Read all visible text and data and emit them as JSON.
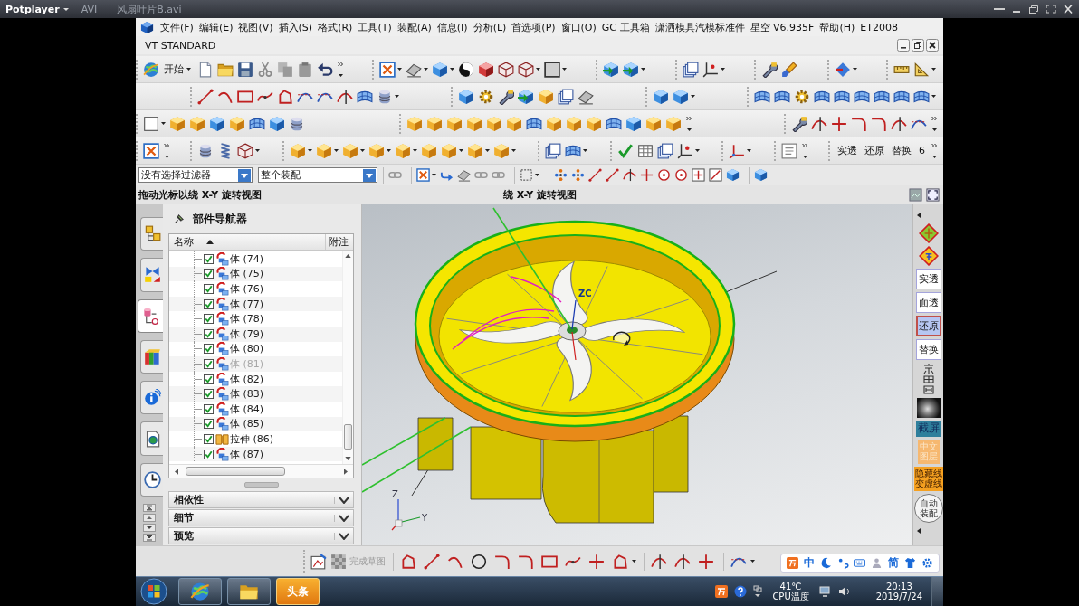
{
  "player": {
    "app": "Potplayer",
    "format": "AVI",
    "file": "风扇叶片B.avi"
  },
  "menu": [
    "文件(F)",
    "编辑(E)",
    "视图(V)",
    "插入(S)",
    "格式(R)",
    "工具(T)",
    "装配(A)",
    "信息(I)",
    "分析(L)",
    "首选项(P)",
    "窗口(O)",
    "GC 工具箱",
    "潇洒模具汽模标准件",
    "星空 V6.935F",
    "帮助(H)",
    "ET2008"
  ],
  "document": {
    "title": "VT STANDARD"
  },
  "toolbar": {
    "start": "开始",
    "text_buttons": [
      "实透",
      "还原",
      "替换",
      "6"
    ]
  },
  "selection_bar": {
    "filter": "没有选择过滤器",
    "scope": "整个装配"
  },
  "status_bar": {
    "prompt": "拖动光标以绕 X-Y 旋转视图",
    "action": "绕 X-Y 旋转视图"
  },
  "resource_tabs": [
    {
      "selected": false
    },
    {
      "selected": false
    },
    {
      "selected": true
    },
    {
      "selected": false
    },
    {
      "selected": false
    },
    {
      "selected": false
    },
    {
      "selected": false
    }
  ],
  "navigator": {
    "title": "部件导航器",
    "columns": [
      "名称",
      "附注"
    ],
    "rows": [
      {
        "label": "体 (74)",
        "kind": "body",
        "checked": true,
        "dimmed": false
      },
      {
        "label": "体 (75)",
        "kind": "body",
        "checked": true,
        "dimmed": false
      },
      {
        "label": "体 (76)",
        "kind": "body",
        "checked": true,
        "dimmed": false
      },
      {
        "label": "体 (77)",
        "kind": "body",
        "checked": true,
        "dimmed": false
      },
      {
        "label": "体 (78)",
        "kind": "body",
        "checked": true,
        "dimmed": false
      },
      {
        "label": "体 (79)",
        "kind": "body",
        "checked": true,
        "dimmed": false
      },
      {
        "label": "体 (80)",
        "kind": "body",
        "checked": true,
        "dimmed": false
      },
      {
        "label": "体 (81)",
        "kind": "body",
        "checked": true,
        "dimmed": true
      },
      {
        "label": "体 (82)",
        "kind": "body",
        "checked": true,
        "dimmed": false
      },
      {
        "label": "体 (83)",
        "kind": "body",
        "checked": true,
        "dimmed": false
      },
      {
        "label": "体 (84)",
        "kind": "body",
        "checked": true,
        "dimmed": false
      },
      {
        "label": "体 (85)",
        "kind": "body",
        "checked": true,
        "dimmed": false
      },
      {
        "label": "拉伸 (86)",
        "kind": "extrude",
        "checked": true,
        "dimmed": false
      },
      {
        "label": "体 (87)",
        "kind": "body",
        "checked": true,
        "dimmed": false
      }
    ],
    "sections": [
      {
        "label": "相依性",
        "expanded": false
      },
      {
        "label": "细节",
        "expanded": false
      },
      {
        "label": "预览",
        "expanded": false
      }
    ]
  },
  "viewport": {
    "axis_label": "ZC",
    "triad": [
      "Z",
      "Y"
    ]
  },
  "right_toolbar": {
    "buttons": [
      {
        "label": "实透",
        "selected": false
      },
      {
        "label": "面透",
        "selected": false
      },
      {
        "label": "还原",
        "selected": true
      },
      {
        "label": "替换",
        "selected": false
      }
    ],
    "tiles": [
      {
        "label": "截屏",
        "kind": "dark"
      },
      {
        "label": "中文图层",
        "kind": "faded"
      },
      {
        "label": "隐藏线变虚线",
        "kind": "bright"
      },
      {
        "label": "自动装配",
        "kind": "round"
      }
    ]
  },
  "sketch_toolbar": {
    "finish": {
      "label": "完成草图",
      "disabled": true
    }
  },
  "ime_bar": {
    "mode": "中",
    "script": "简"
  },
  "taskbar": {
    "app": "头条",
    "temperature": "41℃",
    "sensor": "CPU温度",
    "time": "20:13",
    "date": "2019/7/24"
  }
}
